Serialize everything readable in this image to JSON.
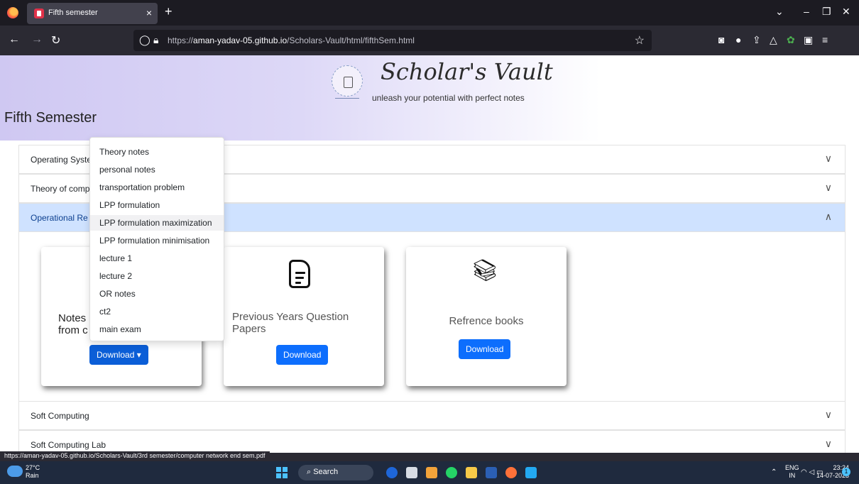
{
  "browser": {
    "tab_title": "Fifth semester",
    "tab_close": "×",
    "new_tab": "+",
    "url_prefix": "https://",
    "url_host": "aman-yadav-05.github.io",
    "url_path": "/Scholars-Vault/html/fifthSem.html",
    "status_url": "https://aman-yadav-05.github.io/Scholars-Vault/3rd semester/computer network end sem.pdf"
  },
  "header": {
    "brand": "Scholar's Vault",
    "tagline": "unleash your potential with perfect notes",
    "page_title": "Fifth Semester"
  },
  "accordion": {
    "items": [
      {
        "label": "Operating Syste",
        "chevron": "∨"
      },
      {
        "label": "Theory of comp",
        "chevron": "∨"
      },
      {
        "label": "Operational Re",
        "chevron": "∧"
      },
      {
        "label": "Soft Computing",
        "chevron": "∨"
      },
      {
        "label": "Soft Computing Lab",
        "chevron": "∨"
      }
    ]
  },
  "cards": [
    {
      "title_line1": "Notes",
      "title_line2": "from c",
      "button": "Download ▾"
    },
    {
      "title": "Previous Years Question Papers",
      "button": "Download"
    },
    {
      "title": "Refrence books",
      "button": "Download"
    }
  ],
  "dropdown": {
    "items": [
      "Theory notes",
      "personal notes",
      "transportation problem",
      "LPP formulation",
      "LPP formulation maximization",
      "LPP formulation minimisation",
      "lecture 1",
      "lecture 2",
      "OR notes",
      "ct2",
      "main exam"
    ]
  },
  "taskbar": {
    "temp": "27°C",
    "weather": "Rain",
    "search": "Search",
    "lang1": "ENG",
    "lang2": "IN",
    "time": "23:24",
    "date": "14-07-2023",
    "notif_count": "1"
  },
  "colors": {
    "primary": "#0d6efd",
    "active_accordion": "#cfe2ff"
  }
}
